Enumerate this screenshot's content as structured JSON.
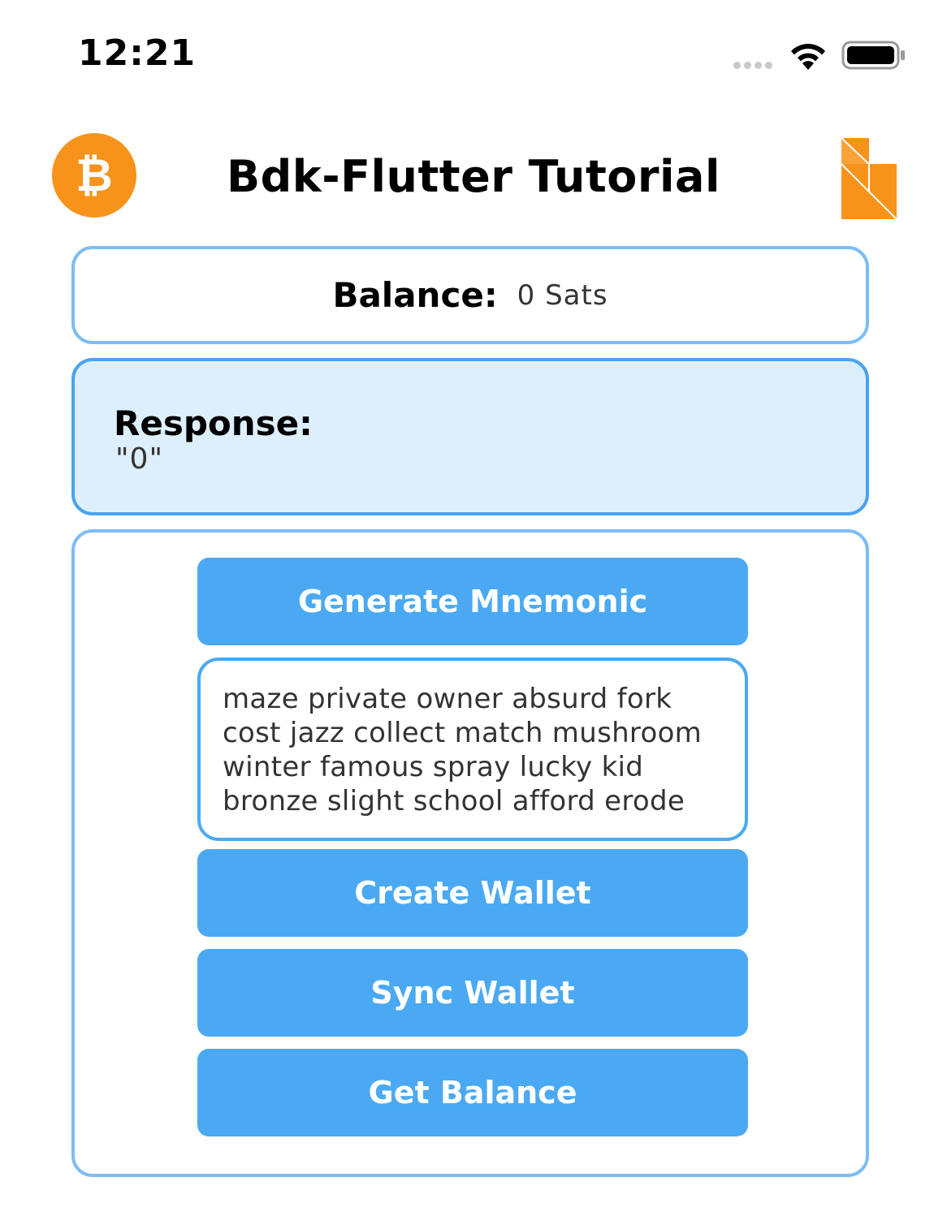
{
  "status_bar": {
    "time": "12:21",
    "icons": [
      "signal-dots-icon",
      "wifi-icon",
      "battery-icon"
    ]
  },
  "header": {
    "title": "Bdk-Flutter Tutorial",
    "left_logo_icon": "bitcoin-logo-icon",
    "left_logo_glyph": "₿",
    "right_logo_icon": "bdk-logo-icon"
  },
  "balance": {
    "label": "Balance:",
    "value": "0 Sats"
  },
  "response": {
    "label": "Response:",
    "value": "\"0\""
  },
  "actions": {
    "generate_mnemonic_label": "Generate Mnemonic",
    "mnemonic_text": "maze private owner absurd fork\ncost jazz collect match mushroom\nwinter famous spray lucky kid\nbronze slight school afford erode",
    "create_wallet_label": "Create Wallet",
    "sync_wallet_label": "Sync Wallet",
    "get_balance_label": "Get Balance"
  },
  "colors": {
    "accent": "#4aa9f2",
    "card_border": "#7dbdf3",
    "response_background": "#ddeffd",
    "bitcoin_orange": "#f7931a"
  }
}
